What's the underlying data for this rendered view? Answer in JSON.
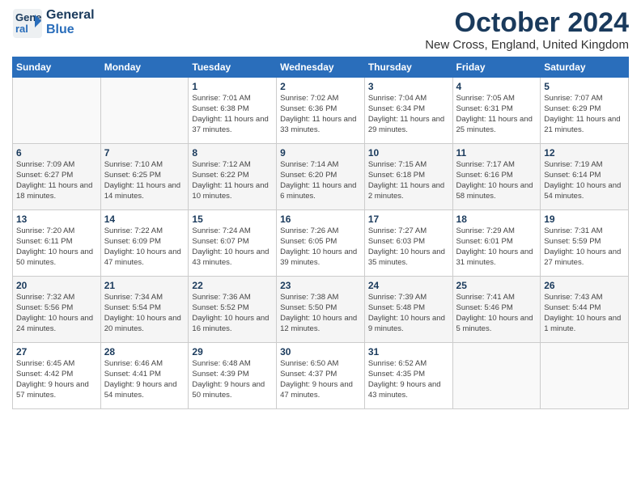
{
  "header": {
    "logo_line1": "General",
    "logo_line2": "Blue",
    "month": "October 2024",
    "location": "New Cross, England, United Kingdom"
  },
  "weekdays": [
    "Sunday",
    "Monday",
    "Tuesday",
    "Wednesday",
    "Thursday",
    "Friday",
    "Saturday"
  ],
  "weeks": [
    [
      {
        "day": "",
        "info": ""
      },
      {
        "day": "",
        "info": ""
      },
      {
        "day": "1",
        "info": "Sunrise: 7:01 AM\nSunset: 6:38 PM\nDaylight: 11 hours and 37 minutes."
      },
      {
        "day": "2",
        "info": "Sunrise: 7:02 AM\nSunset: 6:36 PM\nDaylight: 11 hours and 33 minutes."
      },
      {
        "day": "3",
        "info": "Sunrise: 7:04 AM\nSunset: 6:34 PM\nDaylight: 11 hours and 29 minutes."
      },
      {
        "day": "4",
        "info": "Sunrise: 7:05 AM\nSunset: 6:31 PM\nDaylight: 11 hours and 25 minutes."
      },
      {
        "day": "5",
        "info": "Sunrise: 7:07 AM\nSunset: 6:29 PM\nDaylight: 11 hours and 21 minutes."
      }
    ],
    [
      {
        "day": "6",
        "info": "Sunrise: 7:09 AM\nSunset: 6:27 PM\nDaylight: 11 hours and 18 minutes."
      },
      {
        "day": "7",
        "info": "Sunrise: 7:10 AM\nSunset: 6:25 PM\nDaylight: 11 hours and 14 minutes."
      },
      {
        "day": "8",
        "info": "Sunrise: 7:12 AM\nSunset: 6:22 PM\nDaylight: 11 hours and 10 minutes."
      },
      {
        "day": "9",
        "info": "Sunrise: 7:14 AM\nSunset: 6:20 PM\nDaylight: 11 hours and 6 minutes."
      },
      {
        "day": "10",
        "info": "Sunrise: 7:15 AM\nSunset: 6:18 PM\nDaylight: 11 hours and 2 minutes."
      },
      {
        "day": "11",
        "info": "Sunrise: 7:17 AM\nSunset: 6:16 PM\nDaylight: 10 hours and 58 minutes."
      },
      {
        "day": "12",
        "info": "Sunrise: 7:19 AM\nSunset: 6:14 PM\nDaylight: 10 hours and 54 minutes."
      }
    ],
    [
      {
        "day": "13",
        "info": "Sunrise: 7:20 AM\nSunset: 6:11 PM\nDaylight: 10 hours and 50 minutes."
      },
      {
        "day": "14",
        "info": "Sunrise: 7:22 AM\nSunset: 6:09 PM\nDaylight: 10 hours and 47 minutes."
      },
      {
        "day": "15",
        "info": "Sunrise: 7:24 AM\nSunset: 6:07 PM\nDaylight: 10 hours and 43 minutes."
      },
      {
        "day": "16",
        "info": "Sunrise: 7:26 AM\nSunset: 6:05 PM\nDaylight: 10 hours and 39 minutes."
      },
      {
        "day": "17",
        "info": "Sunrise: 7:27 AM\nSunset: 6:03 PM\nDaylight: 10 hours and 35 minutes."
      },
      {
        "day": "18",
        "info": "Sunrise: 7:29 AM\nSunset: 6:01 PM\nDaylight: 10 hours and 31 minutes."
      },
      {
        "day": "19",
        "info": "Sunrise: 7:31 AM\nSunset: 5:59 PM\nDaylight: 10 hours and 27 minutes."
      }
    ],
    [
      {
        "day": "20",
        "info": "Sunrise: 7:32 AM\nSunset: 5:56 PM\nDaylight: 10 hours and 24 minutes."
      },
      {
        "day": "21",
        "info": "Sunrise: 7:34 AM\nSunset: 5:54 PM\nDaylight: 10 hours and 20 minutes."
      },
      {
        "day": "22",
        "info": "Sunrise: 7:36 AM\nSunset: 5:52 PM\nDaylight: 10 hours and 16 minutes."
      },
      {
        "day": "23",
        "info": "Sunrise: 7:38 AM\nSunset: 5:50 PM\nDaylight: 10 hours and 12 minutes."
      },
      {
        "day": "24",
        "info": "Sunrise: 7:39 AM\nSunset: 5:48 PM\nDaylight: 10 hours and 9 minutes."
      },
      {
        "day": "25",
        "info": "Sunrise: 7:41 AM\nSunset: 5:46 PM\nDaylight: 10 hours and 5 minutes."
      },
      {
        "day": "26",
        "info": "Sunrise: 7:43 AM\nSunset: 5:44 PM\nDaylight: 10 hours and 1 minute."
      }
    ],
    [
      {
        "day": "27",
        "info": "Sunrise: 6:45 AM\nSunset: 4:42 PM\nDaylight: 9 hours and 57 minutes."
      },
      {
        "day": "28",
        "info": "Sunrise: 6:46 AM\nSunset: 4:41 PM\nDaylight: 9 hours and 54 minutes."
      },
      {
        "day": "29",
        "info": "Sunrise: 6:48 AM\nSunset: 4:39 PM\nDaylight: 9 hours and 50 minutes."
      },
      {
        "day": "30",
        "info": "Sunrise: 6:50 AM\nSunset: 4:37 PM\nDaylight: 9 hours and 47 minutes."
      },
      {
        "day": "31",
        "info": "Sunrise: 6:52 AM\nSunset: 4:35 PM\nDaylight: 9 hours and 43 minutes."
      },
      {
        "day": "",
        "info": ""
      },
      {
        "day": "",
        "info": ""
      }
    ]
  ]
}
